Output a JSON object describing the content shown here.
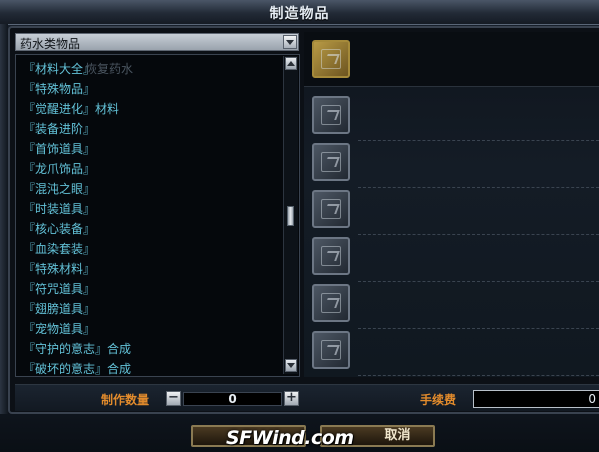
{
  "window": {
    "title": "制造物品"
  },
  "category_dropdown": {
    "value": "药水类物品"
  },
  "list": {
    "items": [
      {
        "label": "『材料大全』",
        "ghost": "恢复药水"
      },
      {
        "label": "『特殊物品』",
        "ghost": ""
      },
      {
        "label": "『觉醒进化』材料",
        "ghost": ""
      },
      {
        "label": "『装备进阶』",
        "ghost": ""
      },
      {
        "label": "『首饰道具』",
        "ghost": ""
      },
      {
        "label": "『龙爪饰品』",
        "ghost": ""
      },
      {
        "label": "『混沌之眼』",
        "ghost": ""
      },
      {
        "label": "『时装道具』",
        "ghost": ""
      },
      {
        "label": "『核心装备』",
        "ghost": ""
      },
      {
        "label": "『血染套装』",
        "ghost": ""
      },
      {
        "label": "『特殊材料』",
        "ghost": ""
      },
      {
        "label": "『符咒道具』",
        "ghost": ""
      },
      {
        "label": "『翅膀道具』",
        "ghost": ""
      },
      {
        "label": "『宠物道具』",
        "ghost": ""
      },
      {
        "label": "『守护的意志』合成",
        "ghost": ""
      },
      {
        "label": "『破坏的意志』合成",
        "ghost": ""
      }
    ]
  },
  "bottom": {
    "quantity_label": "制作数量",
    "minus": "−",
    "plus": "+",
    "quantity_value": "0",
    "fee_label": "手续费",
    "fee_value": "0"
  },
  "buttons": {
    "cancel_label": "取消"
  },
  "watermark": "SFWind.com",
  "colors": {
    "accent_orange": "#e28b2c",
    "list_text": "#63c2d8",
    "gold_slot": "#b89a45"
  }
}
